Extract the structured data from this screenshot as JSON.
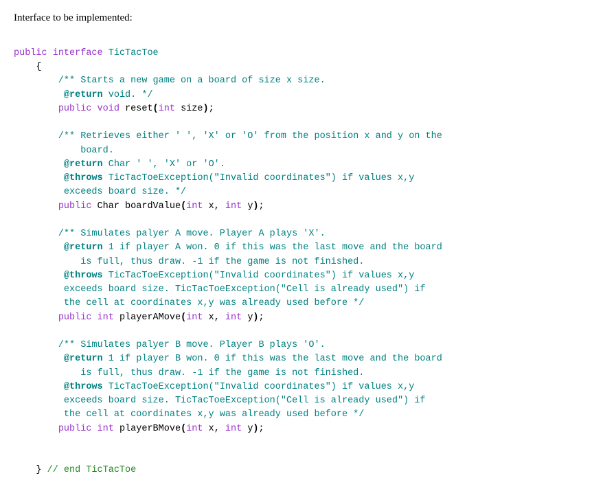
{
  "heading": "Interface to be implemented:",
  "code": {
    "kw_public": "public",
    "kw_interface": "interface",
    "kw_void": "void",
    "kw_int": "int",
    "cls_name": "TicTacToe",
    "brace_open": "{",
    "brace_close": "}",
    "paren_open": "(",
    "paren_close": ")",
    "semicolon": ";",
    "comma": ",",
    "tag_return": "@return",
    "tag_throws": "@throws",
    "reset": {
      "comment_1": "/** Starts a new game on a board of size x size.",
      "return_text": " void. */",
      "method": " reset",
      "param1": " size"
    },
    "boardValue": {
      "comment_1": "/** Retrieves either ' ', 'X' or 'O' from the position x and y on the",
      "comment_1b": "    board.",
      "return_text": " Char ' ', 'X' or 'O'.",
      "throws_text": " TicTacToeException(\"Invalid coordinates\") if values x,y",
      "throws_text2": " exceeds board size. */",
      "ret_type": " Char",
      "method": " boardValue",
      "p1": " x",
      "p2": " y"
    },
    "playerA": {
      "comment_1": "/** Simulates palyer A move. Player A plays 'X'.",
      "return_text": " 1 if player A won. 0 if this was the last move and the board",
      "return_text2": "    is full, thus draw. -1 if the game is not finished.",
      "throws_text": " TicTacToeException(\"Invalid coordinates\") if values x,y",
      "throws_text2": " exceeds board size. TicTacToeException(\"Cell is already used\") if",
      "throws_text3": " the cell at coordinates x,y was already used before */",
      "method": " playerAMove",
      "p1": " x",
      "p2": " y"
    },
    "playerB": {
      "comment_1": "/** Simulates palyer B move. Player B plays 'O'.",
      "return_text": " 1 if player B won. 0 if this was the last move and the board",
      "return_text2": "    is full, thus draw. -1 if the game is not finished.",
      "throws_text": " TicTacToeException(\"Invalid coordinates\") if values x,y",
      "throws_text2": " exceeds board size. TicTacToeException(\"Cell is already used\") if",
      "throws_text3": " the cell at coordinates x,y was already used before */",
      "method": " playerBMove",
      "p1": " x",
      "p2": " y"
    },
    "end_comment": " // end TicTacToe"
  }
}
